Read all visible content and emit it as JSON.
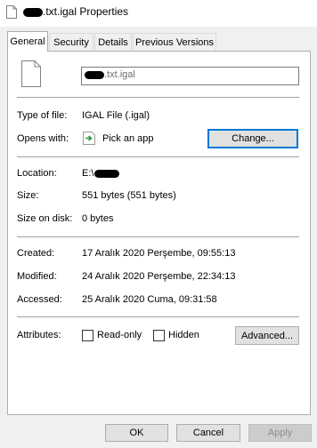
{
  "window": {
    "title": ".txt.igal Properties"
  },
  "tabs": [
    {
      "label": "General",
      "active": true
    },
    {
      "label": "Security",
      "active": false
    },
    {
      "label": "Details",
      "active": false
    },
    {
      "label": "Previous Versions",
      "active": false
    }
  ],
  "file_name_value": ".txt.igal",
  "type": {
    "label": "Type of file:",
    "value": "IGAL File (.igal)"
  },
  "opens": {
    "label": "Opens with:",
    "value": "Pick an app",
    "change_button": "Change..."
  },
  "location": {
    "label": "Location:",
    "value": "E:\\"
  },
  "size": {
    "label": "Size:",
    "value": "551 bytes (551 bytes)"
  },
  "size_on_disk": {
    "label": "Size on disk:",
    "value": "0 bytes"
  },
  "created": {
    "label": "Created:",
    "value": "17 Aralık 2020 Perşembe, 09:55:13"
  },
  "modified": {
    "label": "Modified:",
    "value": "24 Aralık 2020 Perşembe, 22:34:13"
  },
  "accessed": {
    "label": "Accessed:",
    "value": "25 Aralık 2020 Cuma, 09:31:58"
  },
  "attributes": {
    "label": "Attributes:",
    "readonly": "Read-only",
    "hidden": "Hidden",
    "advanced_button": "Advanced..."
  },
  "buttons": {
    "ok": "OK",
    "cancel": "Cancel",
    "apply": "Apply"
  },
  "colors": {
    "focus_border": "#0078d7",
    "app_icon_green": "#2e9a3a"
  }
}
